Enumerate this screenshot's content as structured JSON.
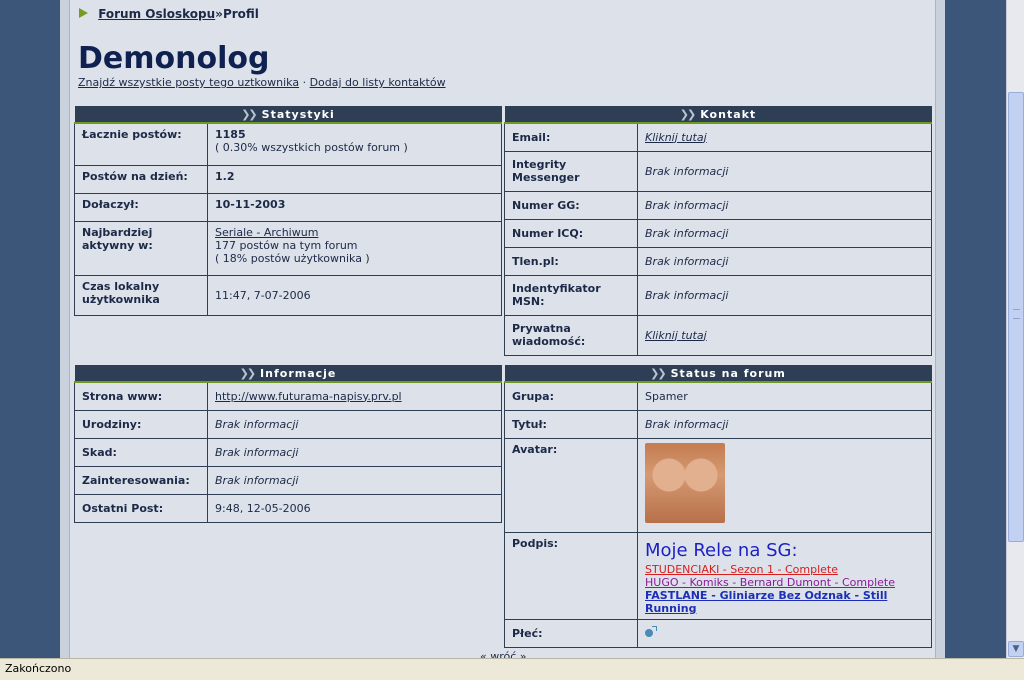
{
  "breadcrumb": {
    "forum": "Forum Osloskopu",
    "sep": "»",
    "current": "Profil"
  },
  "profile": {
    "username": "Demonolog",
    "find_posts": "Znajdź wszystkie posty tego uztkownika",
    "link_sep": " · ",
    "add_contact": "Dodaj do listy kontaktów"
  },
  "stats": {
    "header": "Statystyki",
    "rows": [
      {
        "label": "Łacznie postów:",
        "value": "1185",
        "note": "( 0.30% wszystkich postów forum )"
      },
      {
        "label": "Postów na dzień:",
        "value": "1.2"
      },
      {
        "label": "Dołaczył:",
        "value": "10-11-2003"
      },
      {
        "label": "Najbardziej aktywny w:",
        "value": "Seriale - Archiwum",
        "note1": "177 postów na tym forum",
        "note2": "( 18% postów użytkownika )"
      },
      {
        "label": "Czas lokalny użytkownika",
        "value": "11:47, 7-07-2006"
      }
    ]
  },
  "contact": {
    "header": "Kontakt",
    "rows": [
      {
        "label": "Email:",
        "value": "Kliknij tutaj"
      },
      {
        "label": "Integrity Messenger",
        "value": "Brak informacji"
      },
      {
        "label": "Numer GG:",
        "value": "Brak informacji"
      },
      {
        "label": "Numer ICQ:",
        "value": "Brak informacji"
      },
      {
        "label": "Tlen.pl:",
        "value": "Brak informacji"
      },
      {
        "label": "Indentyfikator MSN:",
        "value": "Brak informacji"
      },
      {
        "label": "Prywatna wiadomość:",
        "value": "Kliknij tutaj"
      }
    ]
  },
  "info": {
    "header": "Informacje",
    "rows": [
      {
        "label": "Strona www:",
        "value": "http://www.futurama-napisy.prv.pl"
      },
      {
        "label": "Urodziny:",
        "value": "Brak informacji"
      },
      {
        "label": "Skad:",
        "value": "Brak informacji"
      },
      {
        "label": "Zainteresowania:",
        "value": "Brak informacji"
      },
      {
        "label": "Ostatni Post:",
        "value": "9:48, 12-05-2006"
      }
    ]
  },
  "status": {
    "header": "Status na forum",
    "group_label": "Grupa:",
    "group": "Spamer",
    "title_label": "Tytuł:",
    "title": "Brak informacji",
    "avatar_label": "Avatar:",
    "signature_label": "Podpis:",
    "signature": {
      "title": "Moje Rele na SG:",
      "line1": "STUDENCIAKI - Sezon 1 - Complete",
      "line2": "HUGO - Komiks - Bernard Dumont - Complete",
      "line3": "FASTLANE - Gliniarze Bez Odznak - Still Running"
    },
    "gender_label": "Płeć:"
  },
  "bottom": "« wróć »",
  "statusbar": "Zakończono",
  "colors": {
    "header_bg": "#2e3e55",
    "header_underline": "#6f9a22",
    "panel_bg": "#dde2ea",
    "outer_bg": "#3c5679"
  }
}
